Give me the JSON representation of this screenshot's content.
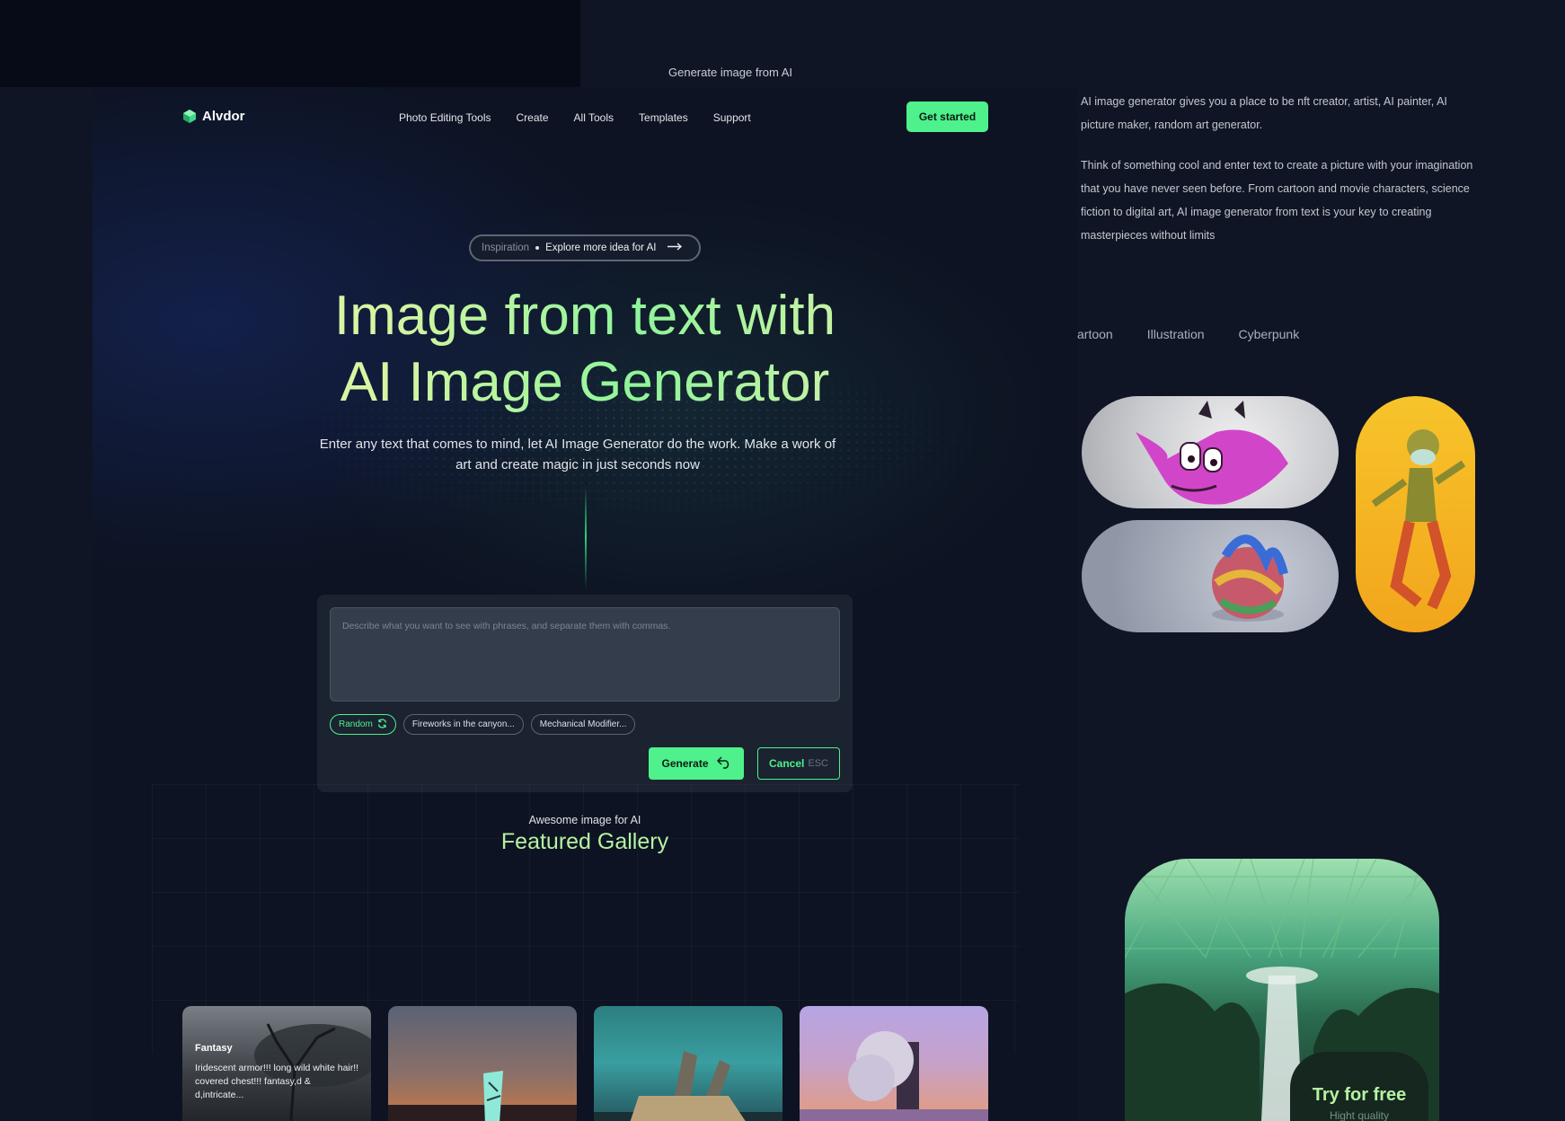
{
  "page_caption": "Generate image from AI",
  "brand": {
    "name": "Alvdor"
  },
  "nav": {
    "items": [
      "Photo Editing Tools",
      "Create",
      "All Tools",
      "Templates",
      "Support"
    ],
    "cta": "Get started"
  },
  "hero": {
    "pill_muted": "Inspiration",
    "pill_link": "Explore more idea for AI",
    "title_line1": "Image from text with",
    "title_line2": "AI Image Generator",
    "subtitle_line1": "Enter any text that comes to mind, let AI Image Generator do the work. Make a work of",
    "subtitle_line2": "art and create magic in just seconds now"
  },
  "generator": {
    "placeholder": "Describe what you want to see with phrases, and separate them with commas.",
    "chips": [
      "Random",
      "Fireworks in the canyon...",
      "Mechanical Modifier..."
    ],
    "generate_label": "Generate",
    "cancel_label": "Cancel",
    "cancel_shortcut": "ESC"
  },
  "gallery": {
    "kicker": "Awesome image for AI",
    "title": "Featured Gallery",
    "cards": [
      {
        "tag": "Fantasy",
        "text": "Iridescent armor!!! long wild white hair!! covered chest!!! fantasy,d & d,intricate..."
      }
    ]
  },
  "side": {
    "paragraph1": "AI image generator gives you a place to be nft creator, artist, AI painter, AI picture maker, random art generator.",
    "paragraph2": "Think of something cool and enter text to create a picture with your imagination that you have never seen before. From cartoon and movie characters, science fiction to digital art, AI image generator from text is your key to creating masterpieces without limits",
    "tabs": [
      "artoon",
      "Illustration",
      "Cyberpunk"
    ],
    "cta_title": "Try for free",
    "cta_sub": "Hight quality"
  },
  "colors": {
    "accent": "#4ef18c",
    "heading_green": "#b6f2a2",
    "bg": "#0f1524"
  },
  "icons": [
    "logo-cube-icon",
    "arrow-right-icon",
    "refresh-icon",
    "return-icon"
  ]
}
